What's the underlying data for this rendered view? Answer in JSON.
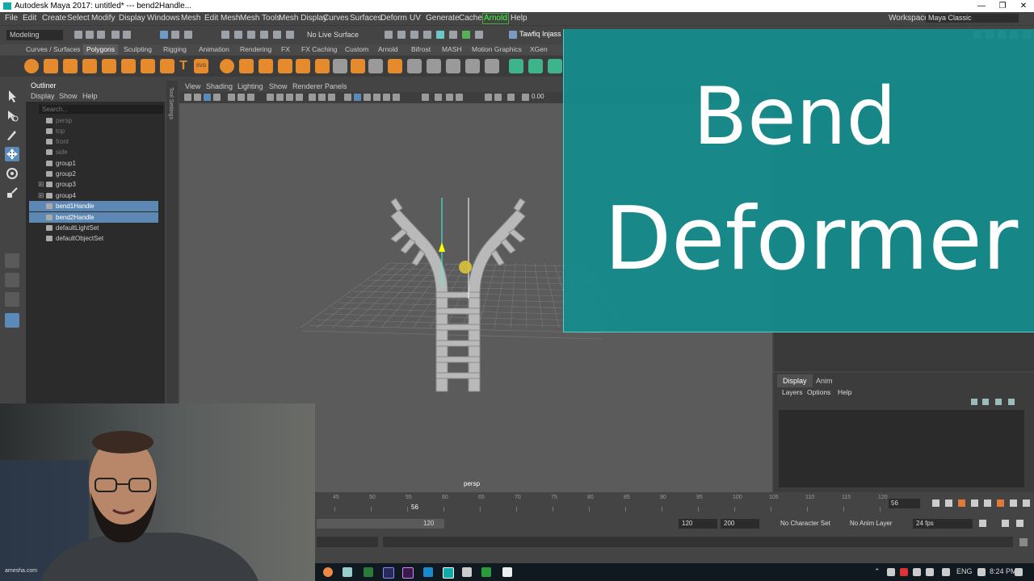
{
  "window": {
    "title": "Autodesk Maya 2017: untitled*  ---  bend2Handle...",
    "controls": [
      "—",
      "❐",
      "✕"
    ]
  },
  "menubar": {
    "items": [
      "File",
      "Edit",
      "Create",
      "Select",
      "Modify",
      "Display",
      "Windows",
      "Mesh",
      "Edit Mesh",
      "Mesh Tools",
      "Mesh Display",
      "Curves",
      "Surfaces",
      "Deform",
      "UV",
      "Generate",
      "Cache",
      "Arnold",
      "Help"
    ],
    "workspace_label": "Workspace :",
    "workspace_value": "Maya Classic"
  },
  "statusline": {
    "mode": "Modeling",
    "live_surface": "No Live Surface",
    "user": "Tawfiq Injass"
  },
  "shelf": {
    "tabs": [
      "Curves / Surfaces",
      "Polygons",
      "Sculpting",
      "Rigging",
      "Animation",
      "Rendering",
      "FX",
      "FX Caching",
      "Custom",
      "Arnold",
      "Bifrost",
      "MASH",
      "Motion Graphics",
      "XGen"
    ],
    "active_tab": "Polygons",
    "icon_labels": [
      "T",
      "SVG"
    ]
  },
  "outliner": {
    "title": "Outliner",
    "menus": [
      "Display",
      "Show",
      "Help"
    ],
    "search_placeholder": "Search...",
    "items": [
      {
        "label": "persp",
        "dim": true,
        "expand": false,
        "selected": false
      },
      {
        "label": "top",
        "dim": true,
        "expand": false,
        "selected": false
      },
      {
        "label": "front",
        "dim": true,
        "expand": false,
        "selected": false
      },
      {
        "label": "side",
        "dim": true,
        "expand": false,
        "selected": false
      },
      {
        "label": "group1",
        "dim": false,
        "expand": false,
        "selected": false
      },
      {
        "label": "group2",
        "dim": false,
        "expand": false,
        "selected": false
      },
      {
        "label": "group3",
        "dim": false,
        "expand": true,
        "selected": false
      },
      {
        "label": "group4",
        "dim": false,
        "expand": true,
        "selected": false
      },
      {
        "label": "bend1Handle",
        "dim": false,
        "expand": false,
        "selected": true
      },
      {
        "label": "bend2Handle",
        "dim": false,
        "expand": false,
        "selected": true
      },
      {
        "label": "defaultLightSet",
        "dim": false,
        "expand": false,
        "selected": false
      },
      {
        "label": "defaultObjectSet",
        "dim": false,
        "expand": false,
        "selected": false
      }
    ]
  },
  "tool_settings_label": "Tool Settings",
  "viewport": {
    "menus": [
      "View",
      "Shading",
      "Lighting",
      "Show",
      "Renderer",
      "Panels"
    ],
    "near_value": "0.00",
    "camera_label": "persp"
  },
  "overlay": {
    "line1": "Bend",
    "line2": "Deformer"
  },
  "layer_panel": {
    "tabs": [
      "Display",
      "Anim"
    ],
    "menus": [
      "Layers",
      "Options",
      "Help"
    ]
  },
  "timeslider": {
    "ticks": [
      "45",
      "50",
      "55",
      "60",
      "65",
      "70",
      "75",
      "80",
      "85",
      "90",
      "95",
      "100",
      "105",
      "110",
      "115",
      "120"
    ],
    "current_frame_marker": "56",
    "current_frame_field": "56"
  },
  "rangeslider": {
    "range_end_inner": "120",
    "end_time": "120",
    "anim_end": "200",
    "character_set": "No Character Set",
    "anim_layer": "No Anim Layer",
    "fps": "24 fps"
  },
  "taskbar": {
    "language": "ENG",
    "time": "8:24 PM"
  },
  "webcam": {
    "watermark": "amesha.com"
  }
}
